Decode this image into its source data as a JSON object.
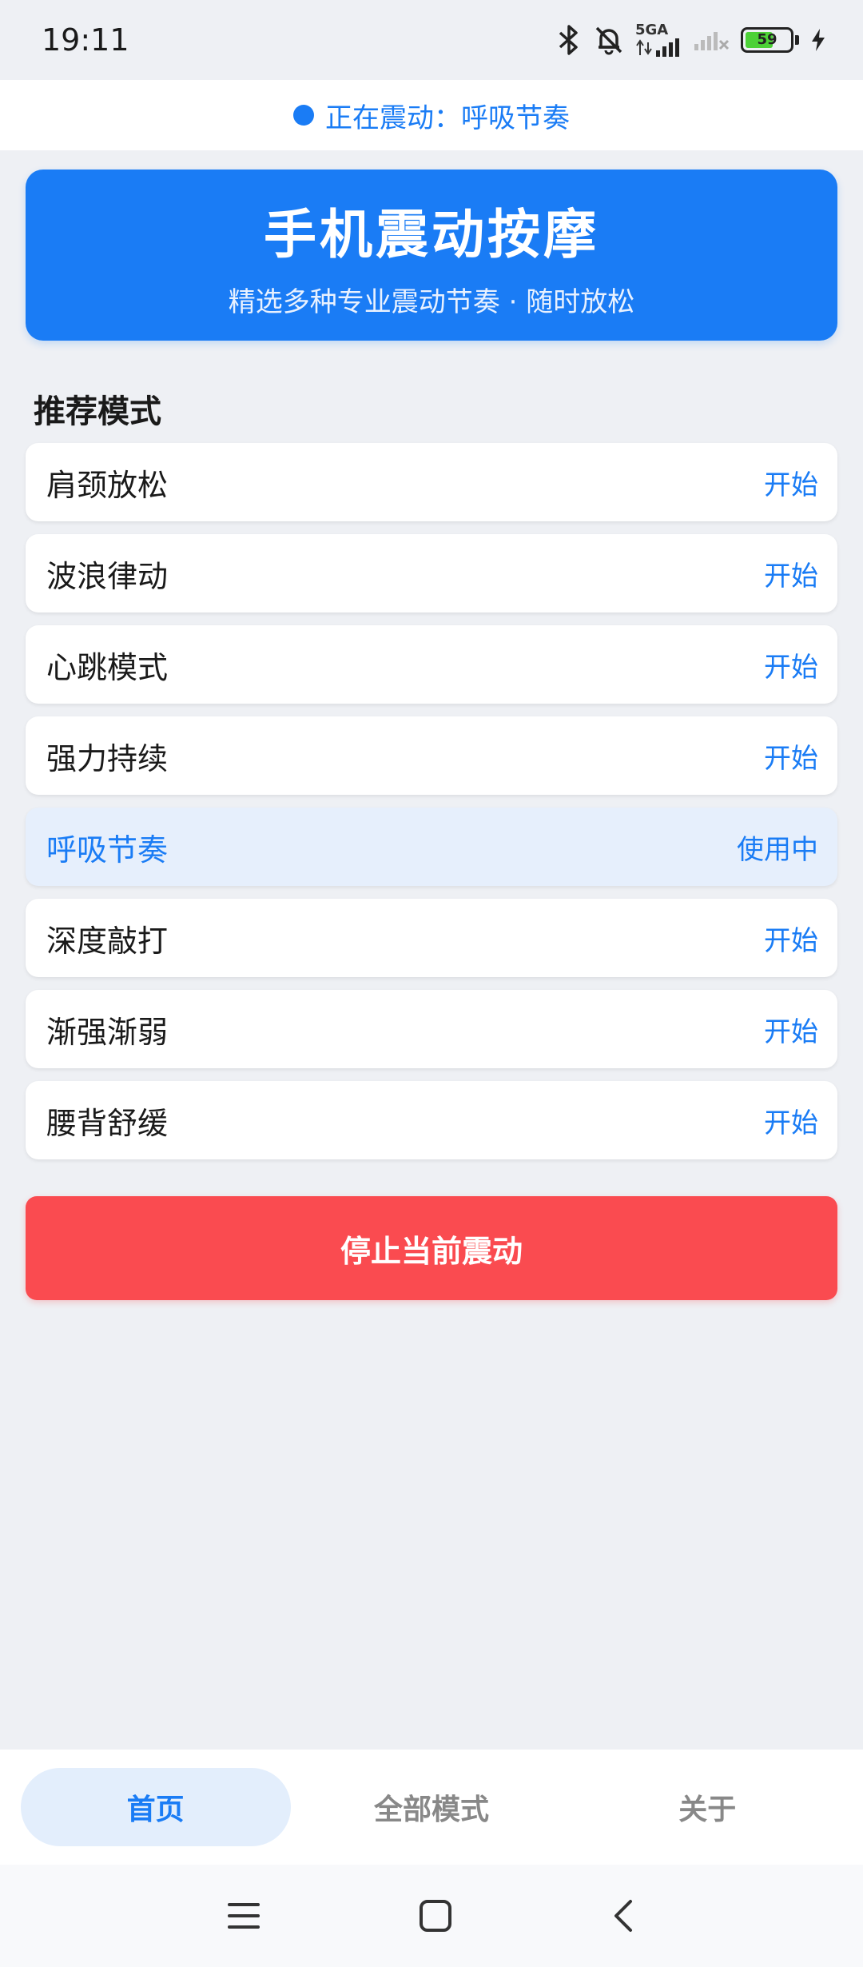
{
  "status_bar": {
    "time": "19:11",
    "network_label": "5GA",
    "battery_level": "59"
  },
  "now_playing": {
    "text": "正在震动：呼吸节奏"
  },
  "hero": {
    "title": "手机震动按摩",
    "subtitle": "精选多种专业震动节奏 · 随时放松"
  },
  "section": {
    "title": "推荐模式"
  },
  "modes": [
    {
      "name": "肩颈放松",
      "action": "开始",
      "active": false
    },
    {
      "name": "波浪律动",
      "action": "开始",
      "active": false
    },
    {
      "name": "心跳模式",
      "action": "开始",
      "active": false
    },
    {
      "name": "强力持续",
      "action": "开始",
      "active": false
    },
    {
      "name": "呼吸节奏",
      "action": "使用中",
      "active": true
    },
    {
      "name": "深度敲打",
      "action": "开始",
      "active": false
    },
    {
      "name": "渐强渐弱",
      "action": "开始",
      "active": false
    },
    {
      "name": "腰背舒缓",
      "action": "开始",
      "active": false
    }
  ],
  "stop_button": {
    "label": "停止当前震动"
  },
  "tabs": [
    {
      "label": "首页",
      "active": true
    },
    {
      "label": "全部模式",
      "active": false
    },
    {
      "label": "关于",
      "active": false
    }
  ],
  "nav": {
    "icons": [
      "menu-icon",
      "home-icon",
      "back-icon"
    ]
  },
  "colors": {
    "accent": "#1a7cf5",
    "danger": "#fa4b50",
    "background": "#eef0f4",
    "active_row": "#e6effc"
  }
}
